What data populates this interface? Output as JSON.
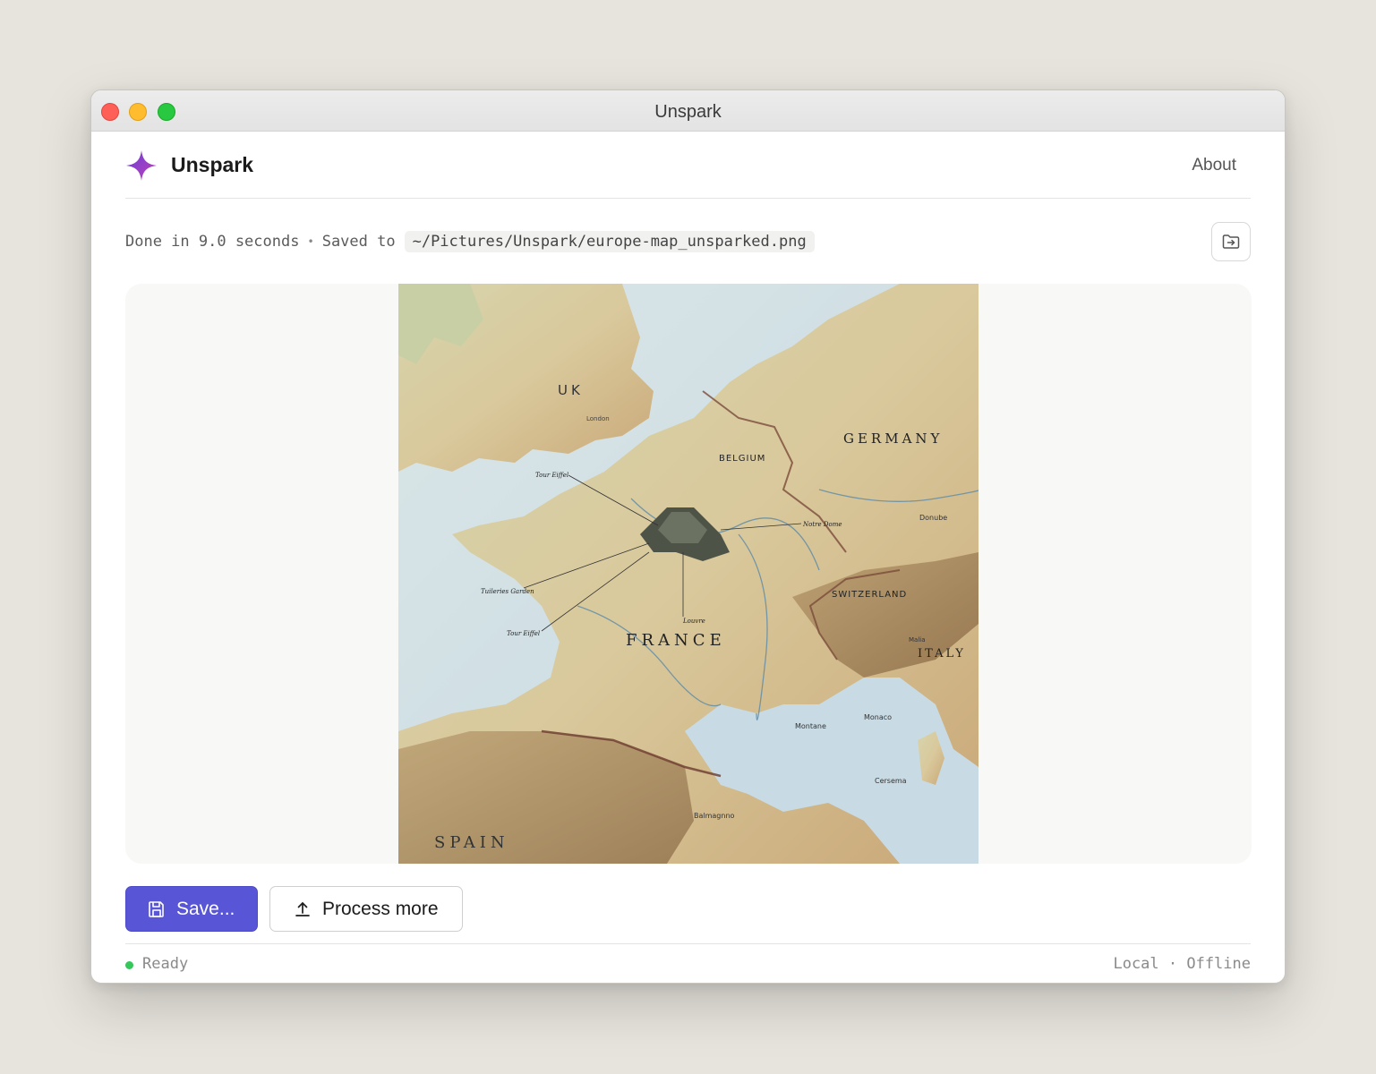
{
  "window": {
    "title": "Unspark"
  },
  "header": {
    "brand": "Unspark",
    "about_label": "About",
    "logo_icon": "sparkle-icon"
  },
  "status": {
    "done_text": "Done in 9.0 seconds",
    "saved_prefix": "Saved to",
    "saved_path": "~/Pictures/Unspark/europe-map_unsparked.png",
    "open_folder_icon": "folder-open-icon"
  },
  "preview": {
    "labels": {
      "uk": "UK",
      "london": "London",
      "germany": "GERMANY",
      "belgium": "BELGIUM",
      "france": "FRANCE",
      "switzerland": "SWITZERLAND",
      "italy": "ITALY",
      "spain": "SPAIN",
      "monaco": "Monaco",
      "donube": "Donube",
      "tour_eiffel_1": "Tour Eiffel",
      "tour_eiffel_2": "Tour Eiffel",
      "tuileries": "Tuileries Garden",
      "louvre": "Louvre",
      "notre_dome": "Notre Dome",
      "montane": "Montane",
      "malia": "Malia",
      "cersema": "Cersema",
      "balmagnno": "Balmagnno"
    }
  },
  "actions": {
    "save_label": "Save...",
    "save_icon": "floppy-disk-icon",
    "process_label": "Process more",
    "process_icon": "upload-icon",
    "accent_color": "#5856d6"
  },
  "footer": {
    "ready": "Ready",
    "mode": "Local · Offline",
    "ready_color": "#34c759"
  }
}
